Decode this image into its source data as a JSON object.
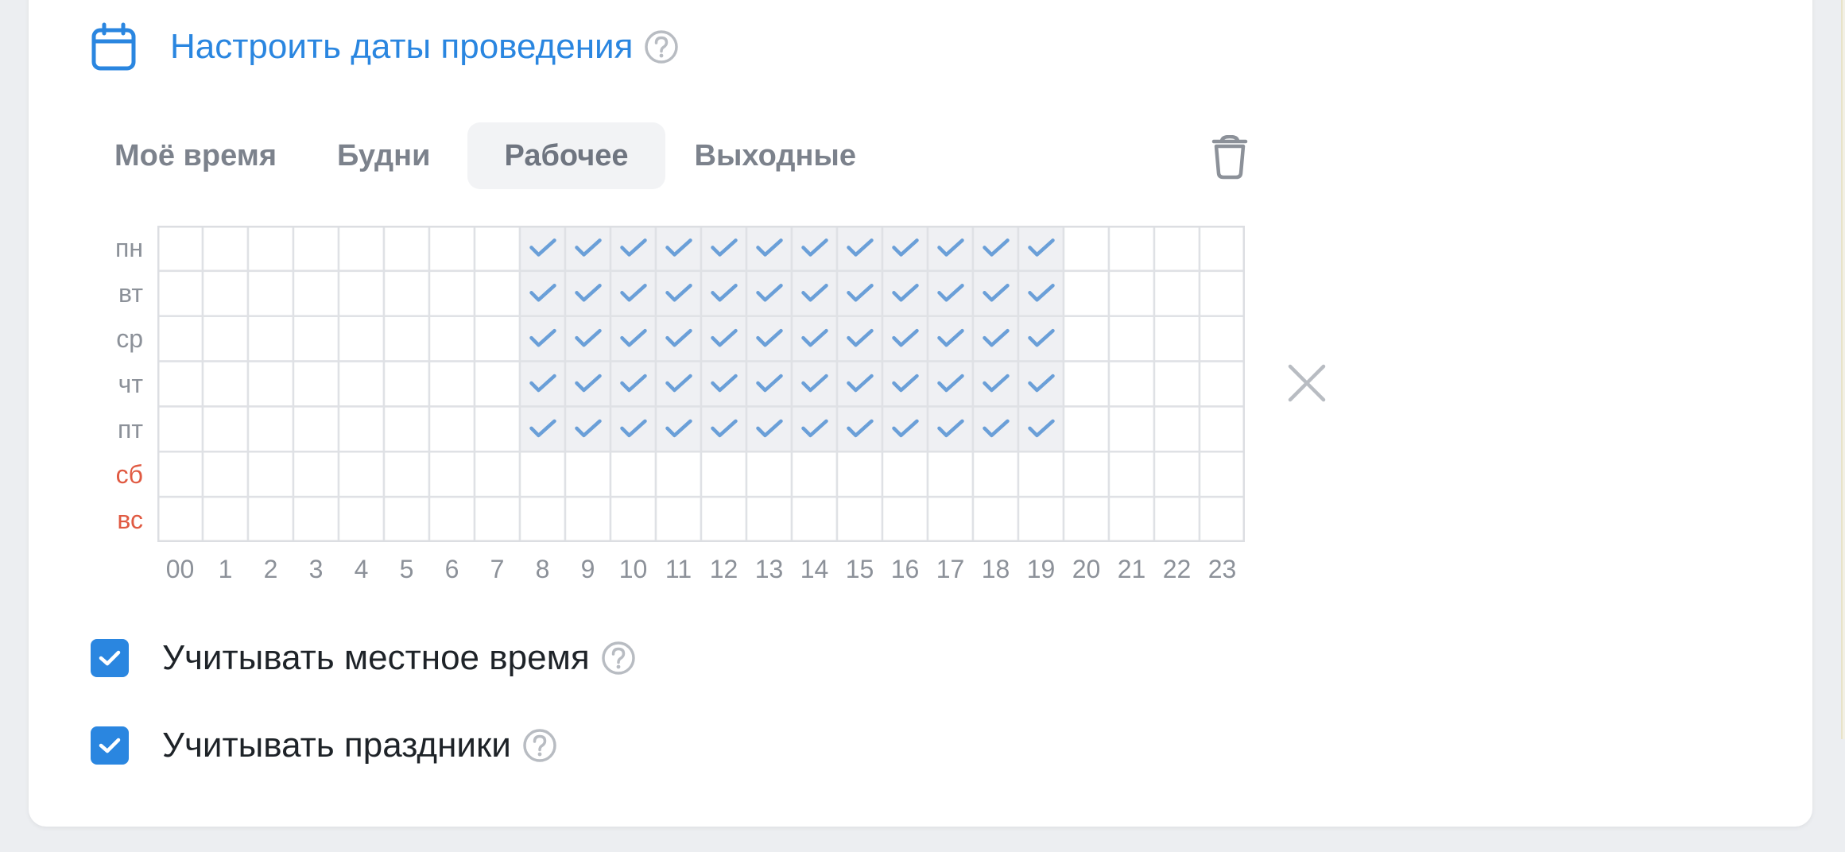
{
  "header": {
    "title": "Настроить даты проведения",
    "icon": "calendar-icon",
    "link_color": "#2a86e0"
  },
  "tabs": [
    {
      "label": "Моё время",
      "active": false
    },
    {
      "label": "Будни",
      "active": false
    },
    {
      "label": "Рабочее",
      "active": true
    },
    {
      "label": "Выходные",
      "active": false
    }
  ],
  "schedule": {
    "days": [
      {
        "label": "пн",
        "weekend": false
      },
      {
        "label": "вт",
        "weekend": false
      },
      {
        "label": "ср",
        "weekend": false
      },
      {
        "label": "чт",
        "weekend": false
      },
      {
        "label": "пт",
        "weekend": false
      },
      {
        "label": "сб",
        "weekend": true
      },
      {
        "label": "вс",
        "weekend": true
      }
    ],
    "hours": [
      "00",
      "1",
      "2",
      "3",
      "4",
      "5",
      "6",
      "7",
      "8",
      "9",
      "10",
      "11",
      "12",
      "13",
      "14",
      "15",
      "16",
      "17",
      "18",
      "19",
      "20",
      "21",
      "22",
      "23"
    ],
    "selected_days": [
      0,
      1,
      2,
      3,
      4
    ],
    "selected_hour_range": [
      8,
      19
    ],
    "check_color": "#6a9fd8",
    "weekend_color": "#e05a42"
  },
  "options": [
    {
      "label": "Учитывать местное время",
      "checked": true
    },
    {
      "label": "Учитывать праздники",
      "checked": true
    }
  ],
  "accent_color": "#2a86e0"
}
